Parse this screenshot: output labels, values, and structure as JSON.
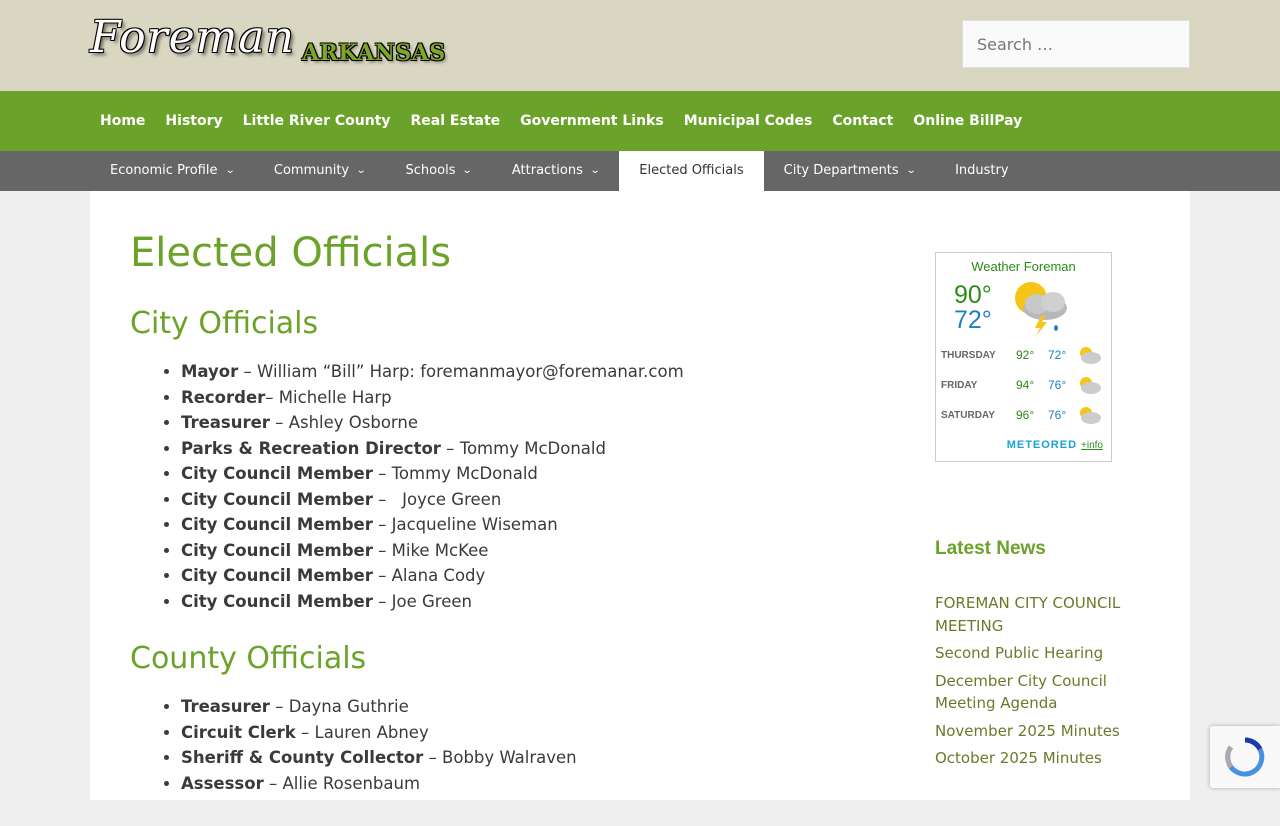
{
  "header": {
    "logo_script": "Foreman",
    "logo_state": "ARKANSAS",
    "search_placeholder": "Search …"
  },
  "primary_nav": [
    "Home",
    "History",
    "Little River County",
    "Real Estate",
    "Government Links",
    "Municipal Codes",
    "Contact",
    "Online BillPay"
  ],
  "secondary_nav": [
    {
      "label": "Economic Profile",
      "dropdown": true
    },
    {
      "label": "Community",
      "dropdown": true
    },
    {
      "label": "Schools",
      "dropdown": true
    },
    {
      "label": "Attractions",
      "dropdown": true
    },
    {
      "label": "Elected Officials",
      "dropdown": false,
      "active": true
    },
    {
      "label": "City Departments",
      "dropdown": true
    },
    {
      "label": "Industry",
      "dropdown": false
    }
  ],
  "page": {
    "title": "Elected Officials",
    "city_heading": "City Officials",
    "city_officials": [
      {
        "role": "Mayor",
        "sep": " – ",
        "name": "William “Bill” Harp: foremanmayor@foremanar.com"
      },
      {
        "role": "Recorder",
        "sep": "– ",
        "name": "Michelle Harp"
      },
      {
        "role": "Treasurer",
        "sep": " – ",
        "name": "Ashley Osborne"
      },
      {
        "role": "Parks & Recreation Director",
        "sep": " – ",
        "name": "Tommy McDonald"
      },
      {
        "role": "City Council Member",
        "sep": " – ",
        "name": "Tommy McDonald"
      },
      {
        "role": "City Council Member",
        "sep": " –   ",
        "name": "Joyce Green"
      },
      {
        "role": "City Council Member",
        "sep": " – ",
        "name": "Jacqueline Wiseman"
      },
      {
        "role": "City Council Member",
        "sep": " – ",
        "name": "Mike McKee"
      },
      {
        "role": "City Council Member",
        "sep": " – ",
        "name": "Alana Cody"
      },
      {
        "role": "City Council Member",
        "sep": " – ",
        "name": "Joe Green"
      }
    ],
    "county_heading": "County Officials",
    "county_officials": [
      {
        "role": "Treasurer",
        "sep": " – ",
        "name": "Dayna Guthrie"
      },
      {
        "role": "Circuit Clerk",
        "sep": " – ",
        "name": "Lauren Abney"
      },
      {
        "role": "Sheriff & County Collector",
        "sep": " – ",
        "name": "Bobby Walraven"
      },
      {
        "role": "Assessor",
        "sep": " – ",
        "name": "Allie Rosenbaum"
      }
    ]
  },
  "weather": {
    "title": "Weather Foreman",
    "today_hi": "90°",
    "today_lo": "72°",
    "forecast": [
      {
        "day": "THURSDAY",
        "hi": "92°",
        "lo": "72°"
      },
      {
        "day": "FRIDAY",
        "hi": "94°",
        "lo": "76°"
      },
      {
        "day": "SATURDAY",
        "hi": "96°",
        "lo": "76°"
      }
    ],
    "brand": "METEORED",
    "info_link": "+info"
  },
  "news": {
    "title": "Latest News",
    "items": [
      "FOREMAN CITY COUNCIL MEETING",
      "Second Public Hearing",
      "December City Council Meeting Agenda",
      "November 2025 Minutes",
      "October 2025 Minutes"
    ]
  }
}
